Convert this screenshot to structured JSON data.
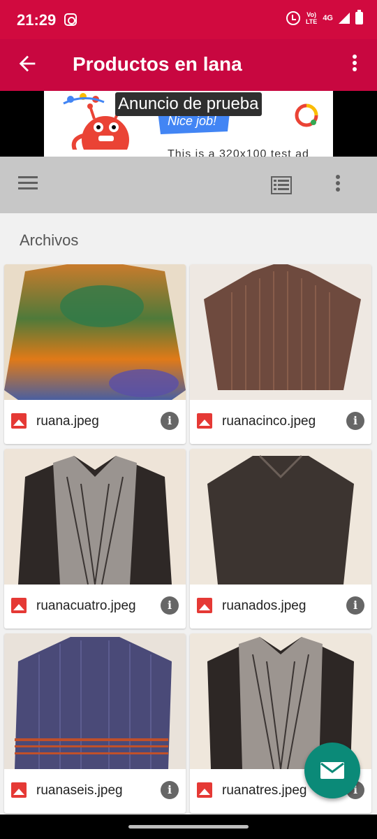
{
  "status": {
    "time": "21:29",
    "lte": "Vo) LTE",
    "network": "4G"
  },
  "appbar": {
    "title": "Productos en lana"
  },
  "ad": {
    "label": "Anuncio de prueba",
    "banner_text": "Nice job!",
    "bottom_text": "This is a 320x100 test ad"
  },
  "section": {
    "title": "Archivos"
  },
  "files": [
    {
      "name": "ruana.jpeg"
    },
    {
      "name": "ruanacinco.jpeg"
    },
    {
      "name": "ruanacuatro.jpeg"
    },
    {
      "name": "ruanados.jpeg"
    },
    {
      "name": "ruanaseis.jpeg"
    },
    {
      "name": "ruanatres.jpeg"
    }
  ],
  "colors": {
    "statusbar": "#d10a3f",
    "appbar": "#c80740",
    "fab": "#0b8a78",
    "toolbar": "#c7c7c7"
  }
}
